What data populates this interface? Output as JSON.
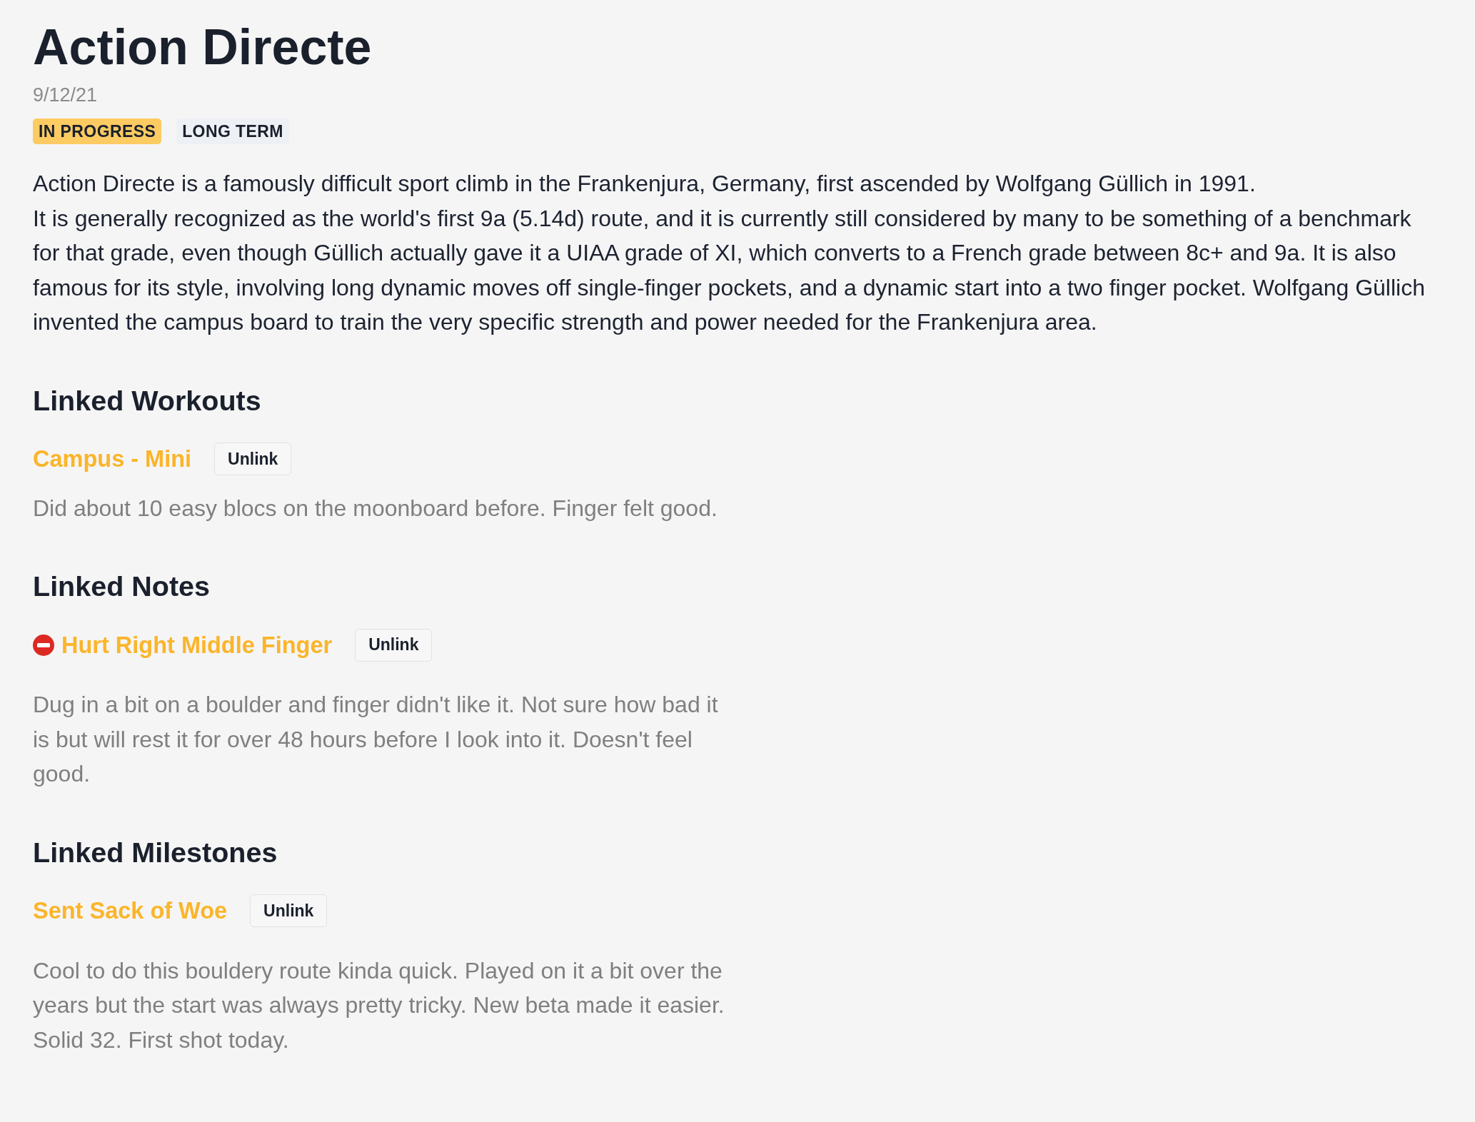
{
  "title": "Action Directe",
  "date": "9/12/21",
  "tags": [
    {
      "label": "IN PROGRESS",
      "color": "#fccb62"
    },
    {
      "label": "LONG TERM",
      "color": "#edf0f4"
    }
  ],
  "description": "Action Directe is a famously difficult sport climb in the Frankenjura, Germany, first ascended by Wolfgang Güllich in 1991.\nIt is generally recognized as the world's first 9a (5.14d) route, and it is currently still considered by many to be something of a benchmark for that grade, even though Güllich actually gave it a UIAA grade of XI, which converts to a French grade between 8c+ and 9a. It is also famous for its style, involving long dynamic moves off single-finger pockets, and a dynamic start into a two finger pocket. Wolfgang Güllich invented the campus board to train the very specific strength and power needed for the Frankenjura area.",
  "sections": [
    {
      "heading": "Linked Workouts",
      "kind": "workouts",
      "items": [
        {
          "title": "Campus - Mini",
          "alert": false,
          "action": "Unlink",
          "text": "Did about 10 easy blocs on the moonboard before. Finger felt good."
        }
      ]
    },
    {
      "heading": "Linked Notes",
      "kind": "notes",
      "items": [
        {
          "title": "Hurt Right Middle Finger",
          "alert": true,
          "action": "Unlink",
          "text": "Dug in a bit on a boulder and finger didn't like it. Not sure how bad it is but will rest it for over 48 hours before I look into it. Doesn't feel good."
        }
      ]
    },
    {
      "heading": "Linked Milestones",
      "kind": "milestones",
      "items": [
        {
          "title": "Sent Sack of Woe",
          "alert": false,
          "action": "Unlink",
          "text": "Cool to do this bouldery route kinda quick. Played on it a bit over the years but the start was always pretty tricky. New beta made it easier. Solid 32. First shot today."
        }
      ]
    }
  ]
}
